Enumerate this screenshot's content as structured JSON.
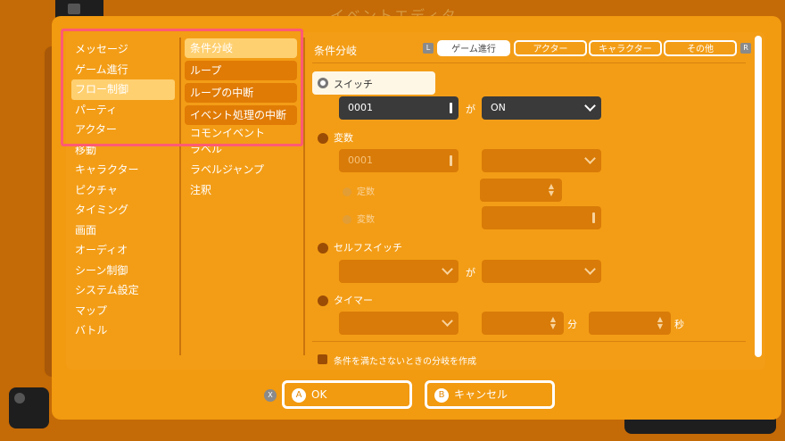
{
  "background": {
    "title": "イベントエディタ"
  },
  "categories": [
    {
      "label": "メッセージ",
      "selected": false
    },
    {
      "label": "ゲーム進行",
      "selected": false
    },
    {
      "label": "フロー制御",
      "selected": true
    },
    {
      "label": "パーティ",
      "selected": false
    },
    {
      "label": "アクター",
      "selected": false
    },
    {
      "label": "移動",
      "selected": false
    },
    {
      "label": "キャラクター",
      "selected": false
    },
    {
      "label": "ピクチャ",
      "selected": false
    },
    {
      "label": "タイミング",
      "selected": false
    },
    {
      "label": "画面",
      "selected": false
    },
    {
      "label": "オーディオ",
      "selected": false
    },
    {
      "label": "シーン制御",
      "selected": false
    },
    {
      "label": "システム設定",
      "selected": false
    },
    {
      "label": "マップ",
      "selected": false
    },
    {
      "label": "バトル",
      "selected": false
    }
  ],
  "commands": [
    {
      "label": "条件分岐",
      "selected": true
    },
    {
      "label": "ループ",
      "selected": false
    },
    {
      "label": "ループの中断",
      "selected": false
    },
    {
      "label": "イベント処理の中断",
      "selected": false
    },
    {
      "label": "コモンイベント",
      "selected": false
    },
    {
      "label": "ラベル",
      "selected": false
    },
    {
      "label": "ラベルジャンプ",
      "selected": false
    },
    {
      "label": "注釈",
      "selected": false
    }
  ],
  "panel": {
    "title": "条件分岐",
    "shoulder_left": "L",
    "shoulder_right": "R",
    "tabs": [
      "ゲーム進行",
      "アクター",
      "キャラクター",
      "その他"
    ],
    "switch_label": "スイッチ",
    "switch_value": "0001",
    "ga": "が",
    "switch_state": "ON",
    "variable_label": "変数",
    "variable_value": "0001",
    "constant_label": "定数",
    "variable2_label": "変数",
    "self_switch_label": "セルフスイッチ",
    "timer_label": "タイマー",
    "minutes": "分",
    "seconds": "秒",
    "else_label": "条件を満たさないときの分岐を作成"
  },
  "buttons": {
    "x_badge": "X",
    "ok_badge": "A",
    "ok_label": "OK",
    "cancel_badge": "B",
    "cancel_label": "キャンセル"
  },
  "colors": {
    "dialog": "#f29a10",
    "highlight": "#ff5a73",
    "selected": "#ffd070",
    "dark_field": "#3a3a3a"
  }
}
